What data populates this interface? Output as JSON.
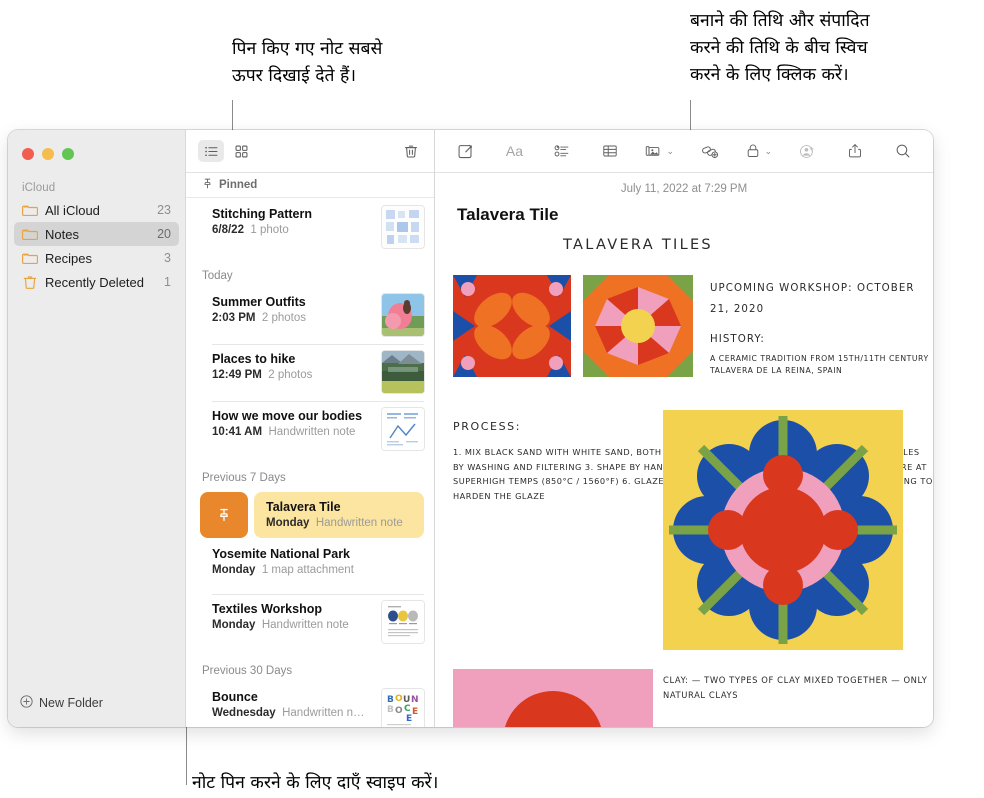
{
  "callouts": {
    "pinned": "पिन किए गए नोट सबसे\nऊपर दिखाई देते हैं।",
    "dates": "बनाने की तिथि और संपादित\nकरने की तिथि के बीच स्विच\nकरने के लिए क्लिक करें।",
    "swipe": "नोट पिन करने के लिए दाएँ स्वाइप करें।"
  },
  "sidebar": {
    "section_label": "iCloud",
    "items": [
      {
        "label": "All iCloud",
        "count": "23",
        "icon": "folder-icon",
        "selected": false
      },
      {
        "label": "Notes",
        "count": "20",
        "icon": "folder-icon",
        "selected": true
      },
      {
        "label": "Recipes",
        "count": "3",
        "icon": "folder-icon",
        "selected": false
      },
      {
        "label": "Recently Deleted",
        "count": "1",
        "icon": "trash-icon",
        "selected": false
      }
    ],
    "new_folder_label": "New Folder"
  },
  "list_toolbar": {
    "list_view_icon": "list-view-icon",
    "gallery_view_icon": "gallery-view-icon",
    "delete_icon": "trash-icon"
  },
  "note_toolbar": {
    "compose_icon": "compose-note-icon",
    "format_icon": "Aa",
    "checklist_icon": "checklist-icon",
    "table_icon": "table-icon",
    "media_icon": "media-icon",
    "media_chevron": "⌄",
    "link_icon": "add-link-icon",
    "lock_icon": "lock-icon",
    "lock_chevron": "⌄",
    "collaborate_icon": "add-people-icon",
    "share_icon": "share-icon",
    "search_icon": "search-icon"
  },
  "list": {
    "pinned_header": "Pinned",
    "pinned_icon": "pin-icon",
    "groups": [
      {
        "header": "",
        "notes": [
          {
            "title": "Stitching Pattern",
            "meta_strong": "6/8/22",
            "meta": "1 photo",
            "thumb": "stitching"
          }
        ]
      },
      {
        "header": "Today",
        "notes": [
          {
            "title": "Summer Outfits",
            "meta_strong": "2:03 PM",
            "meta": "2 photos",
            "thumb": "summer"
          },
          {
            "title": "Places to hike",
            "meta_strong": "12:49 PM",
            "meta": "2 photos",
            "thumb": "hike"
          },
          {
            "title": "How we move our bodies",
            "meta_strong": "10:41 AM",
            "meta": "Handwritten note",
            "thumb": "bodies"
          }
        ]
      },
      {
        "header": "Previous 7 Days",
        "notes": [
          {
            "title": "Talavera Tile",
            "meta_strong": "Monday",
            "meta": "Handwritten note",
            "thumb": "",
            "swipe": true
          },
          {
            "title": "Yosemite National Park",
            "meta_strong": "Monday",
            "meta": "1 map attachment",
            "thumb": ""
          },
          {
            "title": "Textiles Workshop",
            "meta_strong": "Monday",
            "meta": "Handwritten note",
            "thumb": "textiles"
          }
        ]
      },
      {
        "header": "Previous 30 Days",
        "notes": [
          {
            "title": "Bounce",
            "meta_strong": "Wednesday",
            "meta": "Handwritten n…",
            "thumb": "bounce"
          }
        ]
      }
    ],
    "swipe_pin_icon": "pin-icon"
  },
  "note": {
    "date": "July 11, 2022 at 7:29 PM",
    "title": "Talavera Tile",
    "handwritten": {
      "heading": "TALAVERA TILES",
      "workshop": "UPCOMING WORKSHOP:\nOCTOBER 21, 2020",
      "history_heading": "HISTORY:",
      "history_body": "A CERAMIC TRADITION FROM 15TH/11TH\nCENTURY TALAVERA DE LA REINA, SPAIN",
      "process_heading": "PROCESS:",
      "process_body": "1. MIX BLACK SAND WITH WHITE\n    SAND, BOTH FROM PUEBLA,\n    MEXICO\n2. KEEP ONLY FINEST PARTICLES BY\n    WASHING AND FILTERING\n3. SHAPE BY HAND ON POTTER'S WHEEL\n4. DRY FOR MANY DAYS\n5. FIRE AT SUPERHIGH TEMPS\n    (850°C / 1560°F)\n6. GLAZE\n7. HAND PAINT BEAUTIFUL DESIGNS\n8. SECOND FIRING TO HARDEN THE\n    GLAZE",
      "clay": "CLAY:\n—  TWO TYPES OF CLAY MIXED TOGETHER\n—  ONLY NATURAL CLAYS"
    }
  },
  "colors": {
    "pin_button": "#e8872b",
    "selected_card": "#fce5a0",
    "folder_icon": "#e8a33d",
    "sidebar_bg": "#ececec",
    "tile_red": "#d9381e",
    "tile_orange": "#ef7124",
    "tile_blue": "#1b4fa8",
    "tile_pink": "#f0a0bd",
    "tile_green": "#7aa348",
    "tile_yellow": "#f3d24f"
  }
}
